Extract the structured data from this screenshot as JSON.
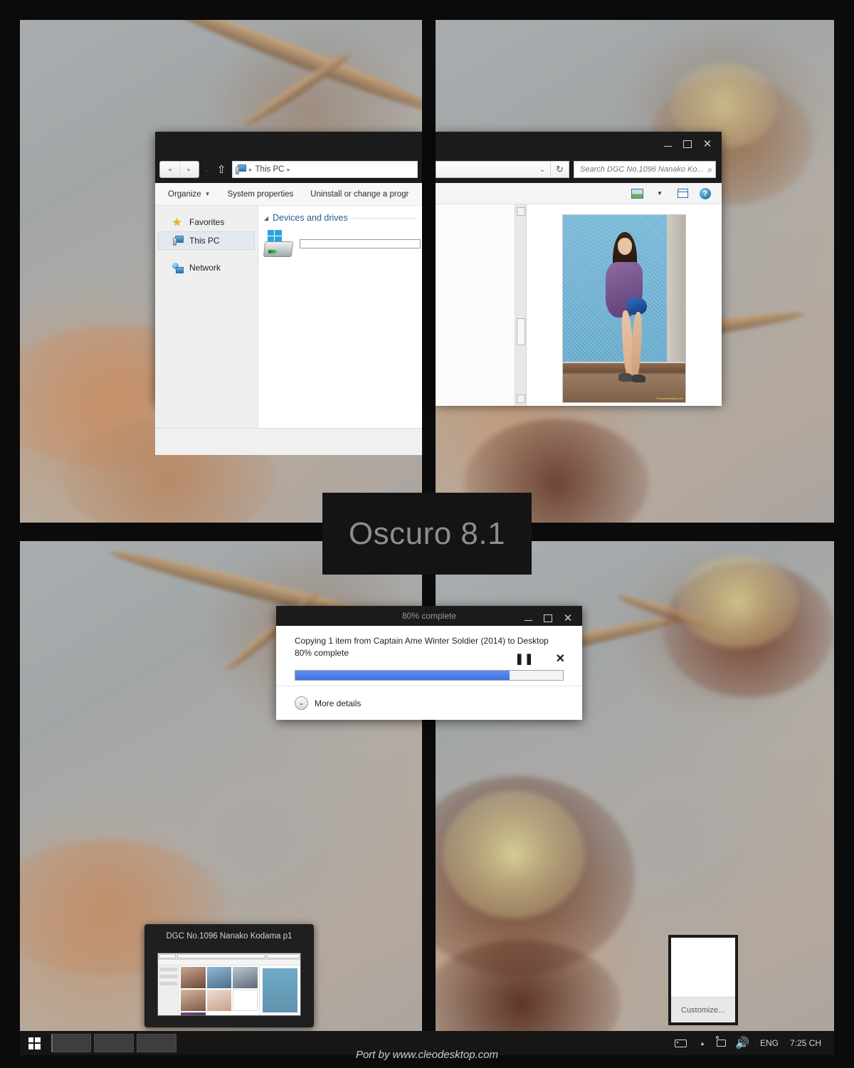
{
  "theme": {
    "name": "Oscuro 8.1",
    "accent": "#3f73e3",
    "chrome_bg": "#1b1b1b",
    "desktop_bg": "#0b0b0b"
  },
  "brand": {
    "title": "Oscuro 8.1"
  },
  "watermark": {
    "text": "Port by www.cleodesktop.com"
  },
  "explorer": {
    "nav": {
      "back": "◂",
      "forward": "▸",
      "history": "⌄",
      "up": "⇧"
    },
    "breadcrumb": {
      "root_icon": "this-pc-icon",
      "sep": "▸",
      "path": "This PC",
      "sep2": "▸"
    },
    "commands": [
      {
        "label": "Organize",
        "has_caret": true
      },
      {
        "label": "System properties",
        "has_caret": false
      },
      {
        "label": "Uninstall or change a progr",
        "has_caret": false
      }
    ],
    "sidebar": [
      {
        "label": "Favorites",
        "icon": "star-icon",
        "selected": false
      },
      {
        "label": "This PC",
        "icon": "this-pc-icon",
        "selected": true
      },
      {
        "label": "Network",
        "icon": "network-icon",
        "selected": false
      }
    ],
    "group": {
      "label": "Devices and drives",
      "expanded": true
    },
    "drive": {
      "icon": "windows-drive-icon",
      "capacity_bar": true
    }
  },
  "viewer": {
    "title": "",
    "window_buttons": {
      "minimize": "–",
      "maximize": "□",
      "close": "✕"
    },
    "address": {
      "value": "",
      "dropdown": "⌄",
      "refresh": "↻"
    },
    "search": {
      "placeholder": "Search DGC No.1096 Nanako Ko...",
      "value": "",
      "icon": "search-icon"
    },
    "toolbar": [
      {
        "name": "preview-pane-icon",
        "caret": true
      },
      {
        "name": "layout-pane-icon",
        "caret": false
      },
      {
        "name": "help-icon",
        "glyph": "?"
      }
    ],
    "photo": {
      "watermark": "© www.cleodesktop.com"
    },
    "scrollbar": {
      "up": "▴",
      "down": "▾"
    }
  },
  "copy_dialog": {
    "title": "80% complete",
    "line1": "Copying 1 item from Captain Ame        Winter Soldier (2014) to Desktop",
    "line1_left": "Copying 1 item from Captain Ame",
    "line1_right": "Winter Soldier (2014) to Desktop",
    "line2": "80% complete",
    "progress_percent": 80,
    "pause_glyph": "▐▐",
    "cancel_glyph": "✕",
    "more_details": "More details",
    "more_details_chevron": "⌄",
    "window_buttons": {
      "minimize": "–",
      "maximize": "□",
      "close": "✕"
    }
  },
  "taskbar_thumbnail": {
    "title": "DGC No.1096 Nanako Kodama p1"
  },
  "tray_flyout": {
    "customize": "Customize..."
  },
  "taskbar": {
    "start": {
      "icon": "windows-start-icon"
    },
    "items": [
      {
        "name": "taskbar-item-1",
        "active": true
      },
      {
        "name": "taskbar-item-2",
        "active": false
      },
      {
        "name": "taskbar-item-3",
        "active": false
      }
    ],
    "tray": {
      "keyboard": "keyboard-icon",
      "show_hidden": "▴",
      "network": "network-tray-icon",
      "volume_glyph": "🔊",
      "language": "ENG",
      "clock": "7:25 CH"
    }
  }
}
